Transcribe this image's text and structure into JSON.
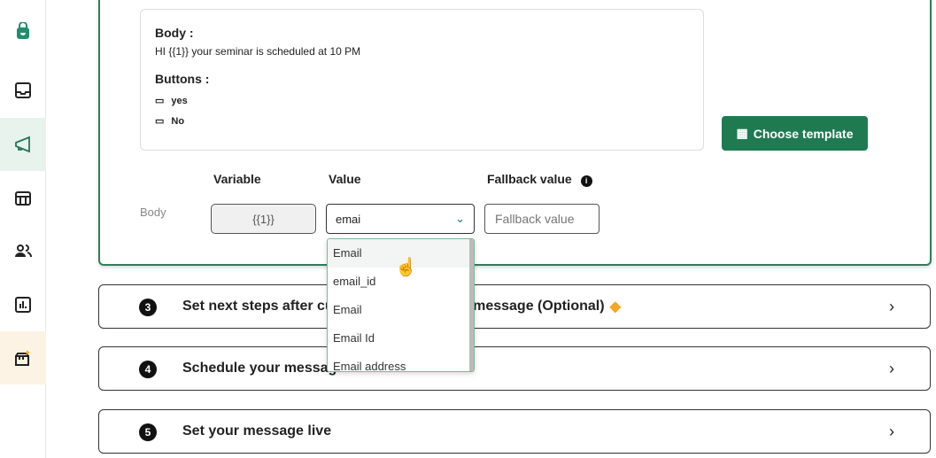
{
  "sidebar": {
    "items": [
      {
        "icon": "shopping-bag-icon"
      },
      {
        "icon": "inbox-icon"
      },
      {
        "icon": "megaphone-icon",
        "active": true
      },
      {
        "icon": "template-icon"
      },
      {
        "icon": "contacts-icon"
      },
      {
        "icon": "analytics-icon"
      },
      {
        "icon": "store-sparkle-icon"
      }
    ]
  },
  "preview": {
    "body_label": "Body :",
    "body_text": "HI {{1}} your seminar is scheduled at 10 PM",
    "buttons_label": "Buttons :",
    "buttons": [
      "yes",
      "No"
    ]
  },
  "choose_template": "Choose template",
  "mapping": {
    "col_variable": "Variable",
    "col_value": "Value",
    "col_fallback": "Fallback value",
    "row_label": "Body",
    "variable": "{{1}}",
    "value": "emai",
    "fallback_placeholder": "Fallback value"
  },
  "dropdown": {
    "options": [
      "Email",
      "email_id",
      "Email",
      "Email Id",
      "Email address"
    ],
    "highlighted": 0
  },
  "steps": [
    {
      "num": "3",
      "title": "Set next steps after customers reply to the message (Optional)"
    },
    {
      "num": "4",
      "title": "Schedule your message"
    },
    {
      "num": "5",
      "title": "Set your message live"
    }
  ],
  "colors": {
    "accent": "#1f7a52",
    "premium": "#f5a623"
  }
}
